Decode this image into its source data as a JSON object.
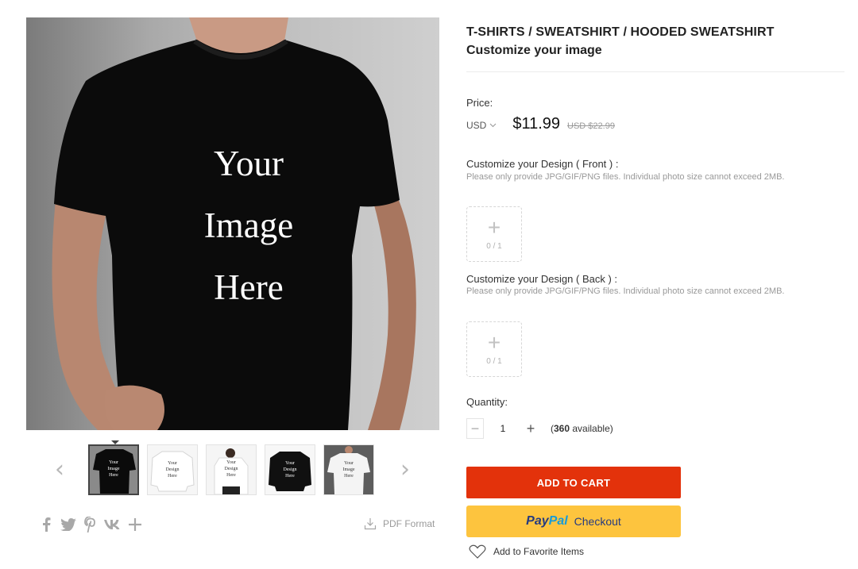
{
  "gallery": {
    "main_caption": [
      "Your",
      "Image",
      "Here"
    ],
    "thumbnails": [
      {
        "caption": [
          "Your",
          "Image",
          "Here"
        ],
        "active": true
      },
      {
        "caption": [
          "Your",
          "Design",
          "Here"
        ],
        "active": false
      },
      {
        "caption": [
          "Your",
          "Design",
          "Here"
        ],
        "active": false
      },
      {
        "caption": [
          "Your",
          "Design",
          "Here"
        ],
        "active": false
      },
      {
        "caption": [
          "Your",
          "Image",
          "Here"
        ],
        "active": false
      }
    ],
    "prev_arrow": "‹",
    "next_arrow": "›"
  },
  "share": {
    "icons": [
      "facebook-icon",
      "twitter-icon",
      "pinterest-icon",
      "vk-icon",
      "plus-icon"
    ]
  },
  "pdf": {
    "label": "PDF Format",
    "icon": "download-icon"
  },
  "product": {
    "breadcrumb": "T-SHIRTS / SWEATSHIRT / HOODED SWEATSHIRT",
    "title": "Customize your image"
  },
  "price": {
    "label": "Price:",
    "currency": "USD",
    "current": "$11.99",
    "original": "USD $22.99"
  },
  "design_front": {
    "label": "Customize your Design ( Front ) :",
    "note": "Please only provide JPG/GIF/PNG files. Individual photo size cannot exceed 2MB.",
    "count": "0 / 1"
  },
  "design_back": {
    "label": "Customize your Design ( Back ) :",
    "note": "Please only provide JPG/GIF/PNG files. Individual photo size cannot exceed 2MB.",
    "count": "0 / 1"
  },
  "quantity": {
    "label": "Quantity:",
    "value": "1",
    "available_count": "360",
    "available_text": "available"
  },
  "actions": {
    "add_to_cart": "ADD TO CART",
    "paypal_brand_1": "Pay",
    "paypal_brand_2": "Pal",
    "paypal_checkout": "Checkout",
    "favorite": "Add to Favorite Items"
  },
  "colors": {
    "add_to_cart": "#e3320b",
    "paypal": "#fdc43e"
  }
}
